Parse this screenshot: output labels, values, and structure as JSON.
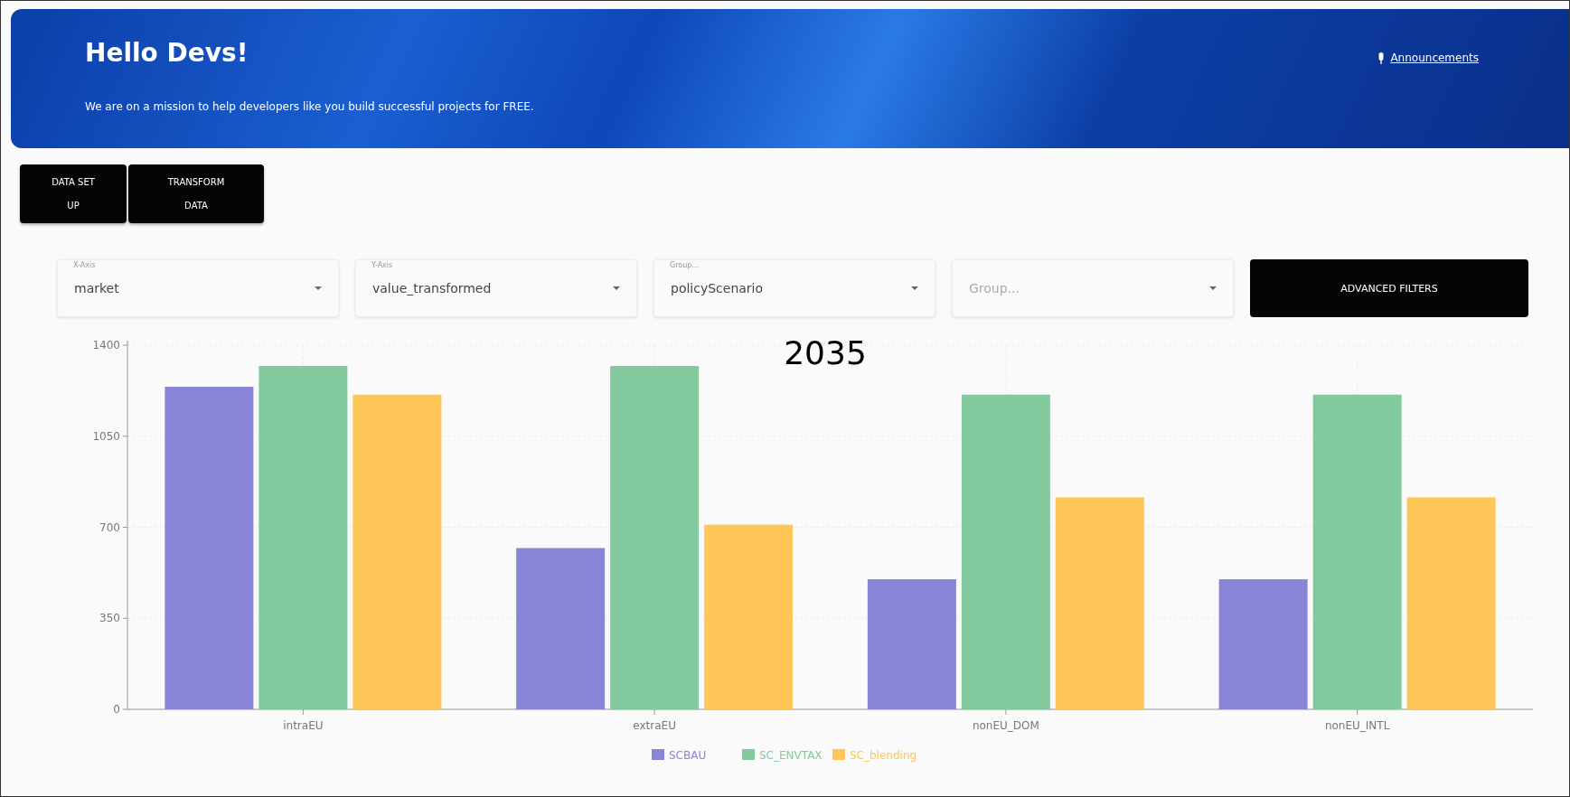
{
  "banner": {
    "title": "Hello Devs!",
    "subtitle": "We are on a mission to help developers like you build successful projects for FREE.",
    "link": "Announcements"
  },
  "tabs": [
    {
      "label": "DATA SET UP"
    },
    {
      "label": "TRANSFORM DATA"
    }
  ],
  "filters": [
    {
      "label": "X-Axis",
      "value": "market"
    },
    {
      "label": "Y-Axis",
      "value": "value_transformed"
    },
    {
      "label": "Group...",
      "value": "policyScenario"
    },
    {
      "placeholder": "Group..."
    }
  ],
  "advanced_button": "ADVANCED FILTERS",
  "chart": {
    "chart_data": {
      "type": "bar",
      "title": "2035",
      "categories": [
        "intraEU",
        "extraEU",
        "nonEU_DOM",
        "nonEU_INTL"
      ],
      "series": [
        {
          "name": "SCBAU",
          "color": "#8884d8",
          "values": [
            1240,
            620,
            500,
            500
          ]
        },
        {
          "name": "SC_ENVTAX",
          "color": "#82ca9d",
          "values": [
            1320,
            1320,
            1210,
            1210
          ]
        },
        {
          "name": "SC_blending",
          "color": "#ffc658",
          "values": [
            1210,
            710,
            815,
            815
          ]
        }
      ],
      "ylim": [
        0,
        1400
      ],
      "yticks": [
        0,
        350,
        700,
        1050,
        1400
      ],
      "grid": true,
      "legend": "bottom"
    }
  }
}
